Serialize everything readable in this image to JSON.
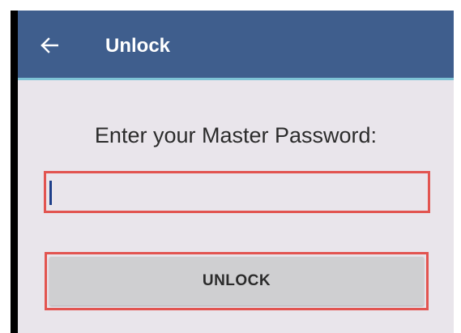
{
  "appbar": {
    "title": "Unlock",
    "back_icon": "arrow-left-icon",
    "color": "#3f5e8d",
    "accent_line_color": "#7ec3d6"
  },
  "main": {
    "prompt": "Enter your Master Password:",
    "password_input": {
      "value": "",
      "placeholder": ""
    },
    "unlock_button": {
      "label": "UNLOCK"
    },
    "highlight_color": "#e25450"
  }
}
